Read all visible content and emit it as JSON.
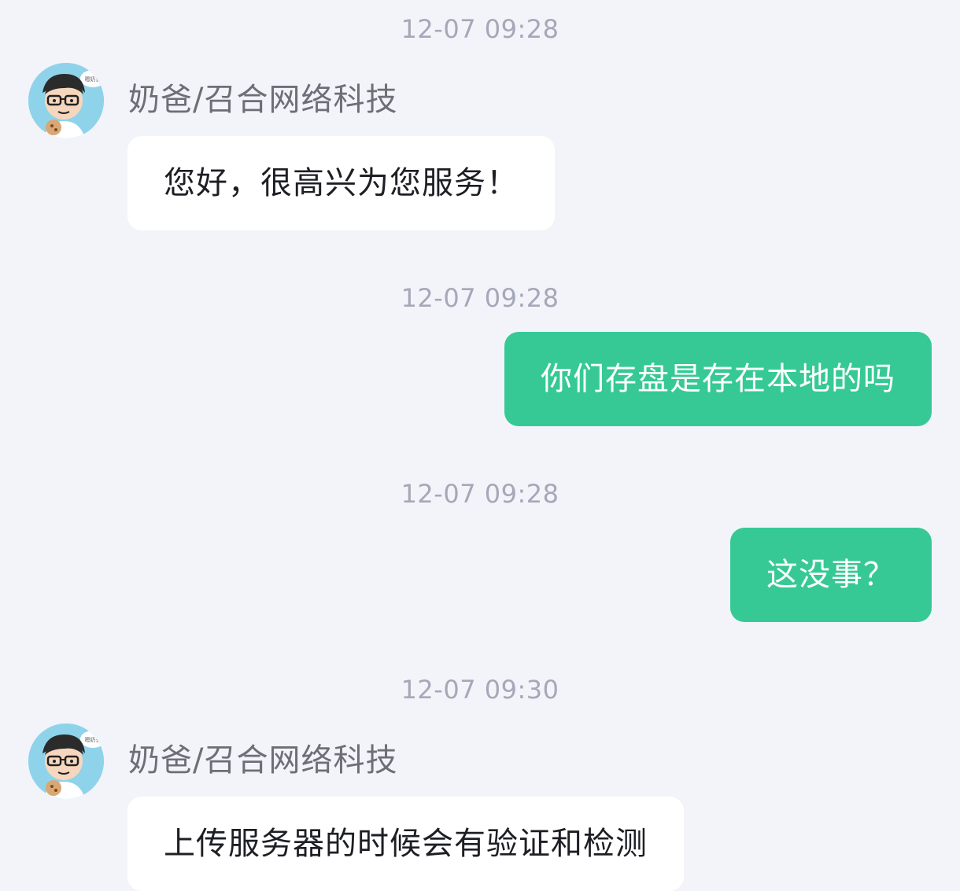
{
  "messages": [
    {
      "timestamp": "12-07 09:28",
      "sender": "agent",
      "sender_name": "奶爸/召合网络科技",
      "text": "您好，很高兴为您服务！"
    },
    {
      "timestamp": "12-07 09:28",
      "sender": "user",
      "text": "你们存盘是存在本地的吗"
    },
    {
      "timestamp": "12-07 09:28",
      "sender": "user",
      "text": "这没事？"
    },
    {
      "timestamp": "12-07 09:30",
      "sender": "agent",
      "sender_name": "奶爸/召合网络科技",
      "text": "上传服务器的时候会有验证和检测"
    }
  ],
  "avatar": {
    "icon": "agent-avatar-cartoon",
    "badge_text": "嗯奶去"
  },
  "colors": {
    "background": "#f3f4fa",
    "agent_bubble": "#ffffff",
    "user_bubble": "#36c995",
    "timestamp": "#a4a8b8",
    "sender_name": "#6d6f78"
  }
}
